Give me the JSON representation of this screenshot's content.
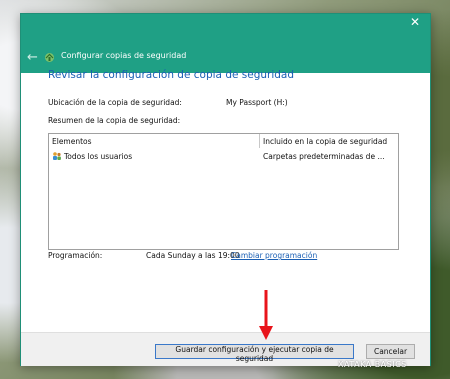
{
  "window": {
    "title": "Configurar copias de seguridad",
    "close_glyph": "✕",
    "back_glyph": "←"
  },
  "main": {
    "heading": "Revisar la configuración de copia de seguridad",
    "location_label": "Ubicación de la copia de seguridad:",
    "location_value": "My Passport (H:)",
    "summary_label": "Resumen de la copia de seguridad:",
    "table": {
      "columns": [
        "Elementos",
        "Incluido en la copia de seguridad"
      ],
      "rows": [
        {
          "item": "Todos los usuarios",
          "included": "Carpetas predeterminadas de ..."
        }
      ]
    },
    "schedule_label": "Programación:",
    "schedule_value": "Cada Sunday a las 19:00",
    "schedule_link": "Cambiar programación"
  },
  "footer": {
    "save_run_label": "Guardar configuración y ejecutar copia de seguridad",
    "cancel_label": "Cancelar"
  },
  "watermark": "XATAKA BASICS",
  "colors": {
    "titlebar": "#1fa085",
    "heading": "#1a5fb4",
    "link": "#1a5fb4",
    "arrow": "#e8141b"
  },
  "icons": [
    "back-arrow-icon",
    "backup-app-icon",
    "close-icon",
    "users-icon",
    "red-arrow-icon"
  ]
}
